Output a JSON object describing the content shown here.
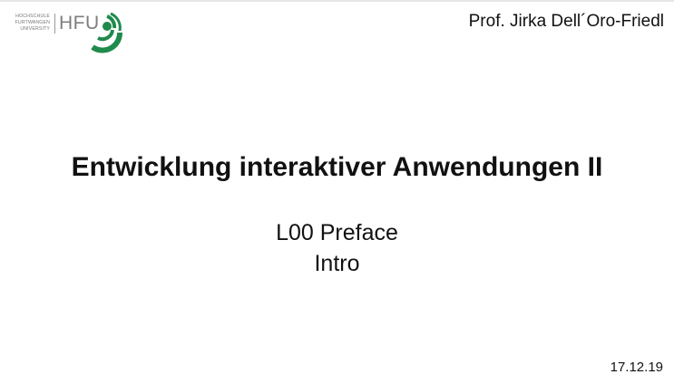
{
  "logo": {
    "institution_lines": [
      "HOCHSCHULE",
      "FURTWANGEN",
      "UNIVERSITY"
    ],
    "abbreviation": "HFU",
    "icon": "hfu-swirl-logo",
    "brand_color": "#1f8a4c"
  },
  "header": {
    "author": "Prof. Jirka Dell´Oro-Friedl"
  },
  "main": {
    "title": "Entwicklung interaktiver Anwendungen II",
    "subtitle_lines": [
      "L00 Preface",
      "Intro"
    ]
  },
  "footer": {
    "date": "17.12.19"
  }
}
